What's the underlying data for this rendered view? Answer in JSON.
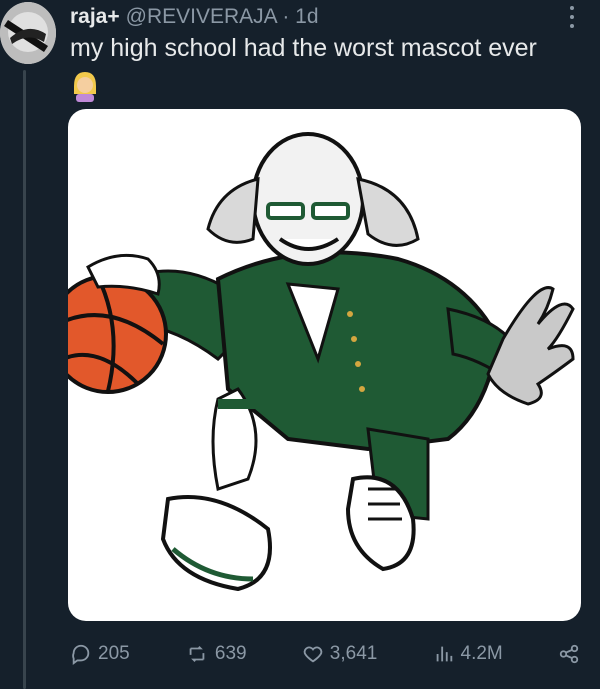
{
  "tweet": {
    "author_name": "raja+",
    "handle_time": "@REVIVERAJA · 1d",
    "text": "my high school had the worst mascot ever",
    "media_description": "mascot-illustration"
  },
  "actions": {
    "replies": "205",
    "reposts": "639",
    "likes": "3,641",
    "views": "4.2M"
  },
  "colors": {
    "background": "#15202b",
    "text": "#e7e9ea",
    "secondary": "#8b98a5",
    "mascot_green": "#1f5a34",
    "ball_orange": "#e2582b"
  },
  "icons": [
    "more-icon",
    "reply-icon",
    "repost-icon",
    "like-icon",
    "views-icon",
    "share-icon",
    "emoji-icon"
  ]
}
